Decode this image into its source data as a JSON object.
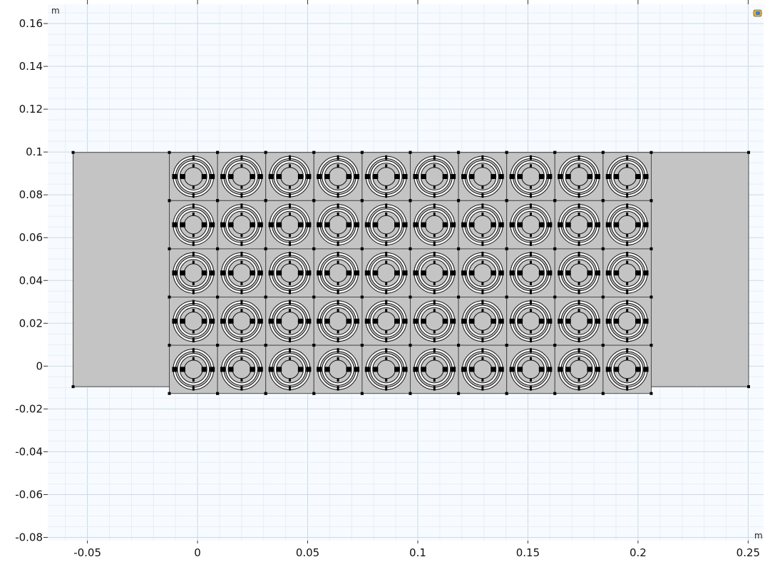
{
  "units": {
    "x": "m",
    "y": "m"
  },
  "axes": {
    "x": {
      "range": [
        -0.068,
        0.257
      ],
      "ticks": [
        {
          "value": -0.05,
          "label": "-0.05"
        },
        {
          "value": 0,
          "label": "0"
        },
        {
          "value": 0.05,
          "label": "0.05"
        },
        {
          "value": 0.1,
          "label": "0.1"
        },
        {
          "value": 0.15,
          "label": "0.15"
        },
        {
          "value": 0.2,
          "label": "0.2"
        },
        {
          "value": 0.25,
          "label": "0.25"
        }
      ]
    },
    "y": {
      "range": [
        -0.0815,
        0.169
      ],
      "ticks": [
        {
          "value": 0.16,
          "label": "0.16"
        },
        {
          "value": 0.14,
          "label": "0.14"
        },
        {
          "value": 0.12,
          "label": "0.12"
        },
        {
          "value": 0.1,
          "label": "0.1"
        },
        {
          "value": 0.08,
          "label": "0.08"
        },
        {
          "value": 0.06,
          "label": "0.06"
        },
        {
          "value": 0.04,
          "label": "0.04"
        },
        {
          "value": 0.02,
          "label": "0.02"
        },
        {
          "value": 0,
          "label": "0"
        },
        {
          "value": -0.02,
          "label": "-0.02"
        },
        {
          "value": -0.04,
          "label": "-0.04"
        },
        {
          "value": -0.06,
          "label": "-0.06"
        },
        {
          "value": -0.08,
          "label": "-0.08"
        }
      ]
    },
    "grid": true
  },
  "geometry": {
    "outer_rect": {
      "x": [
        -0.0565,
        0.2502
      ],
      "y": [
        -0.0096,
        0.0998
      ]
    },
    "array": {
      "x_start": -0.0128,
      "cell_size": 0.02188,
      "columns": 10,
      "rows": 5,
      "y_top": 0.0998
    },
    "colors": {
      "fill": "#c4c4c4",
      "edge": "#4a4a4a",
      "points": "#000000",
      "grid_minor": "#e6eef6",
      "grid_major": "#c9d9ea",
      "plot_bg": "#f7fbff"
    }
  }
}
